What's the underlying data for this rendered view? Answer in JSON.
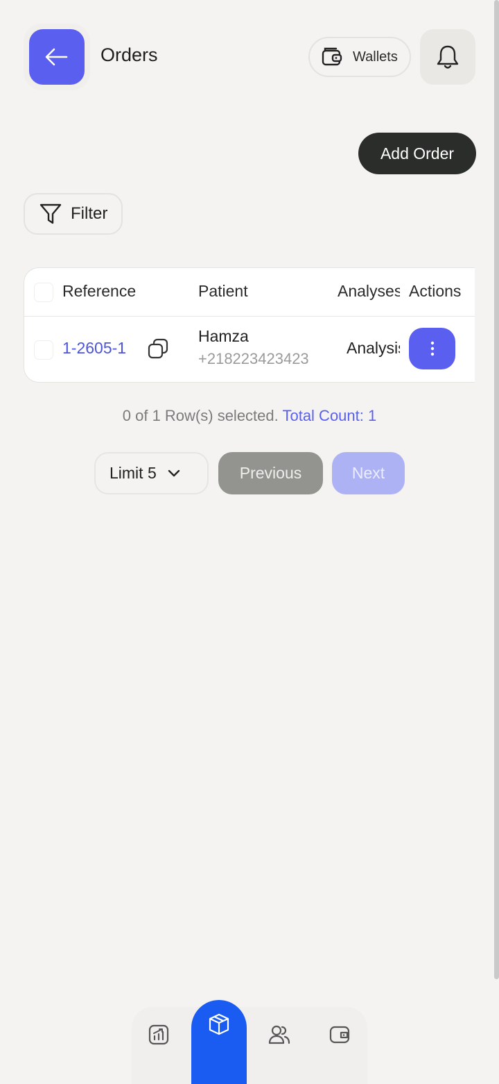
{
  "header": {
    "title": "Orders",
    "wallets_label": "Wallets"
  },
  "toolbar": {
    "add_order_label": "Add Order",
    "filter_label": "Filter"
  },
  "table": {
    "columns": [
      "Reference",
      "Patient",
      "Analyses",
      "Actions"
    ],
    "rows": [
      {
        "reference": "1-2605-1",
        "patient_name": "Hamza",
        "patient_phone": "+218223423423",
        "analyses": "Analysis"
      }
    ]
  },
  "selection": {
    "summary": "0 of 1 Row(s) selected.",
    "total_count": "Total Count: 1"
  },
  "pagination": {
    "limit_label": "Limit 5",
    "previous_label": "Previous",
    "next_label": "Next"
  },
  "colors": {
    "accent": "#5a5ff0",
    "nav_active": "#1a5cf2",
    "dark_button": "#2b2d2b"
  },
  "nav": {
    "items": [
      "chart-icon",
      "box-icon",
      "users-icon",
      "wallet-icon"
    ],
    "active": "box-icon"
  }
}
